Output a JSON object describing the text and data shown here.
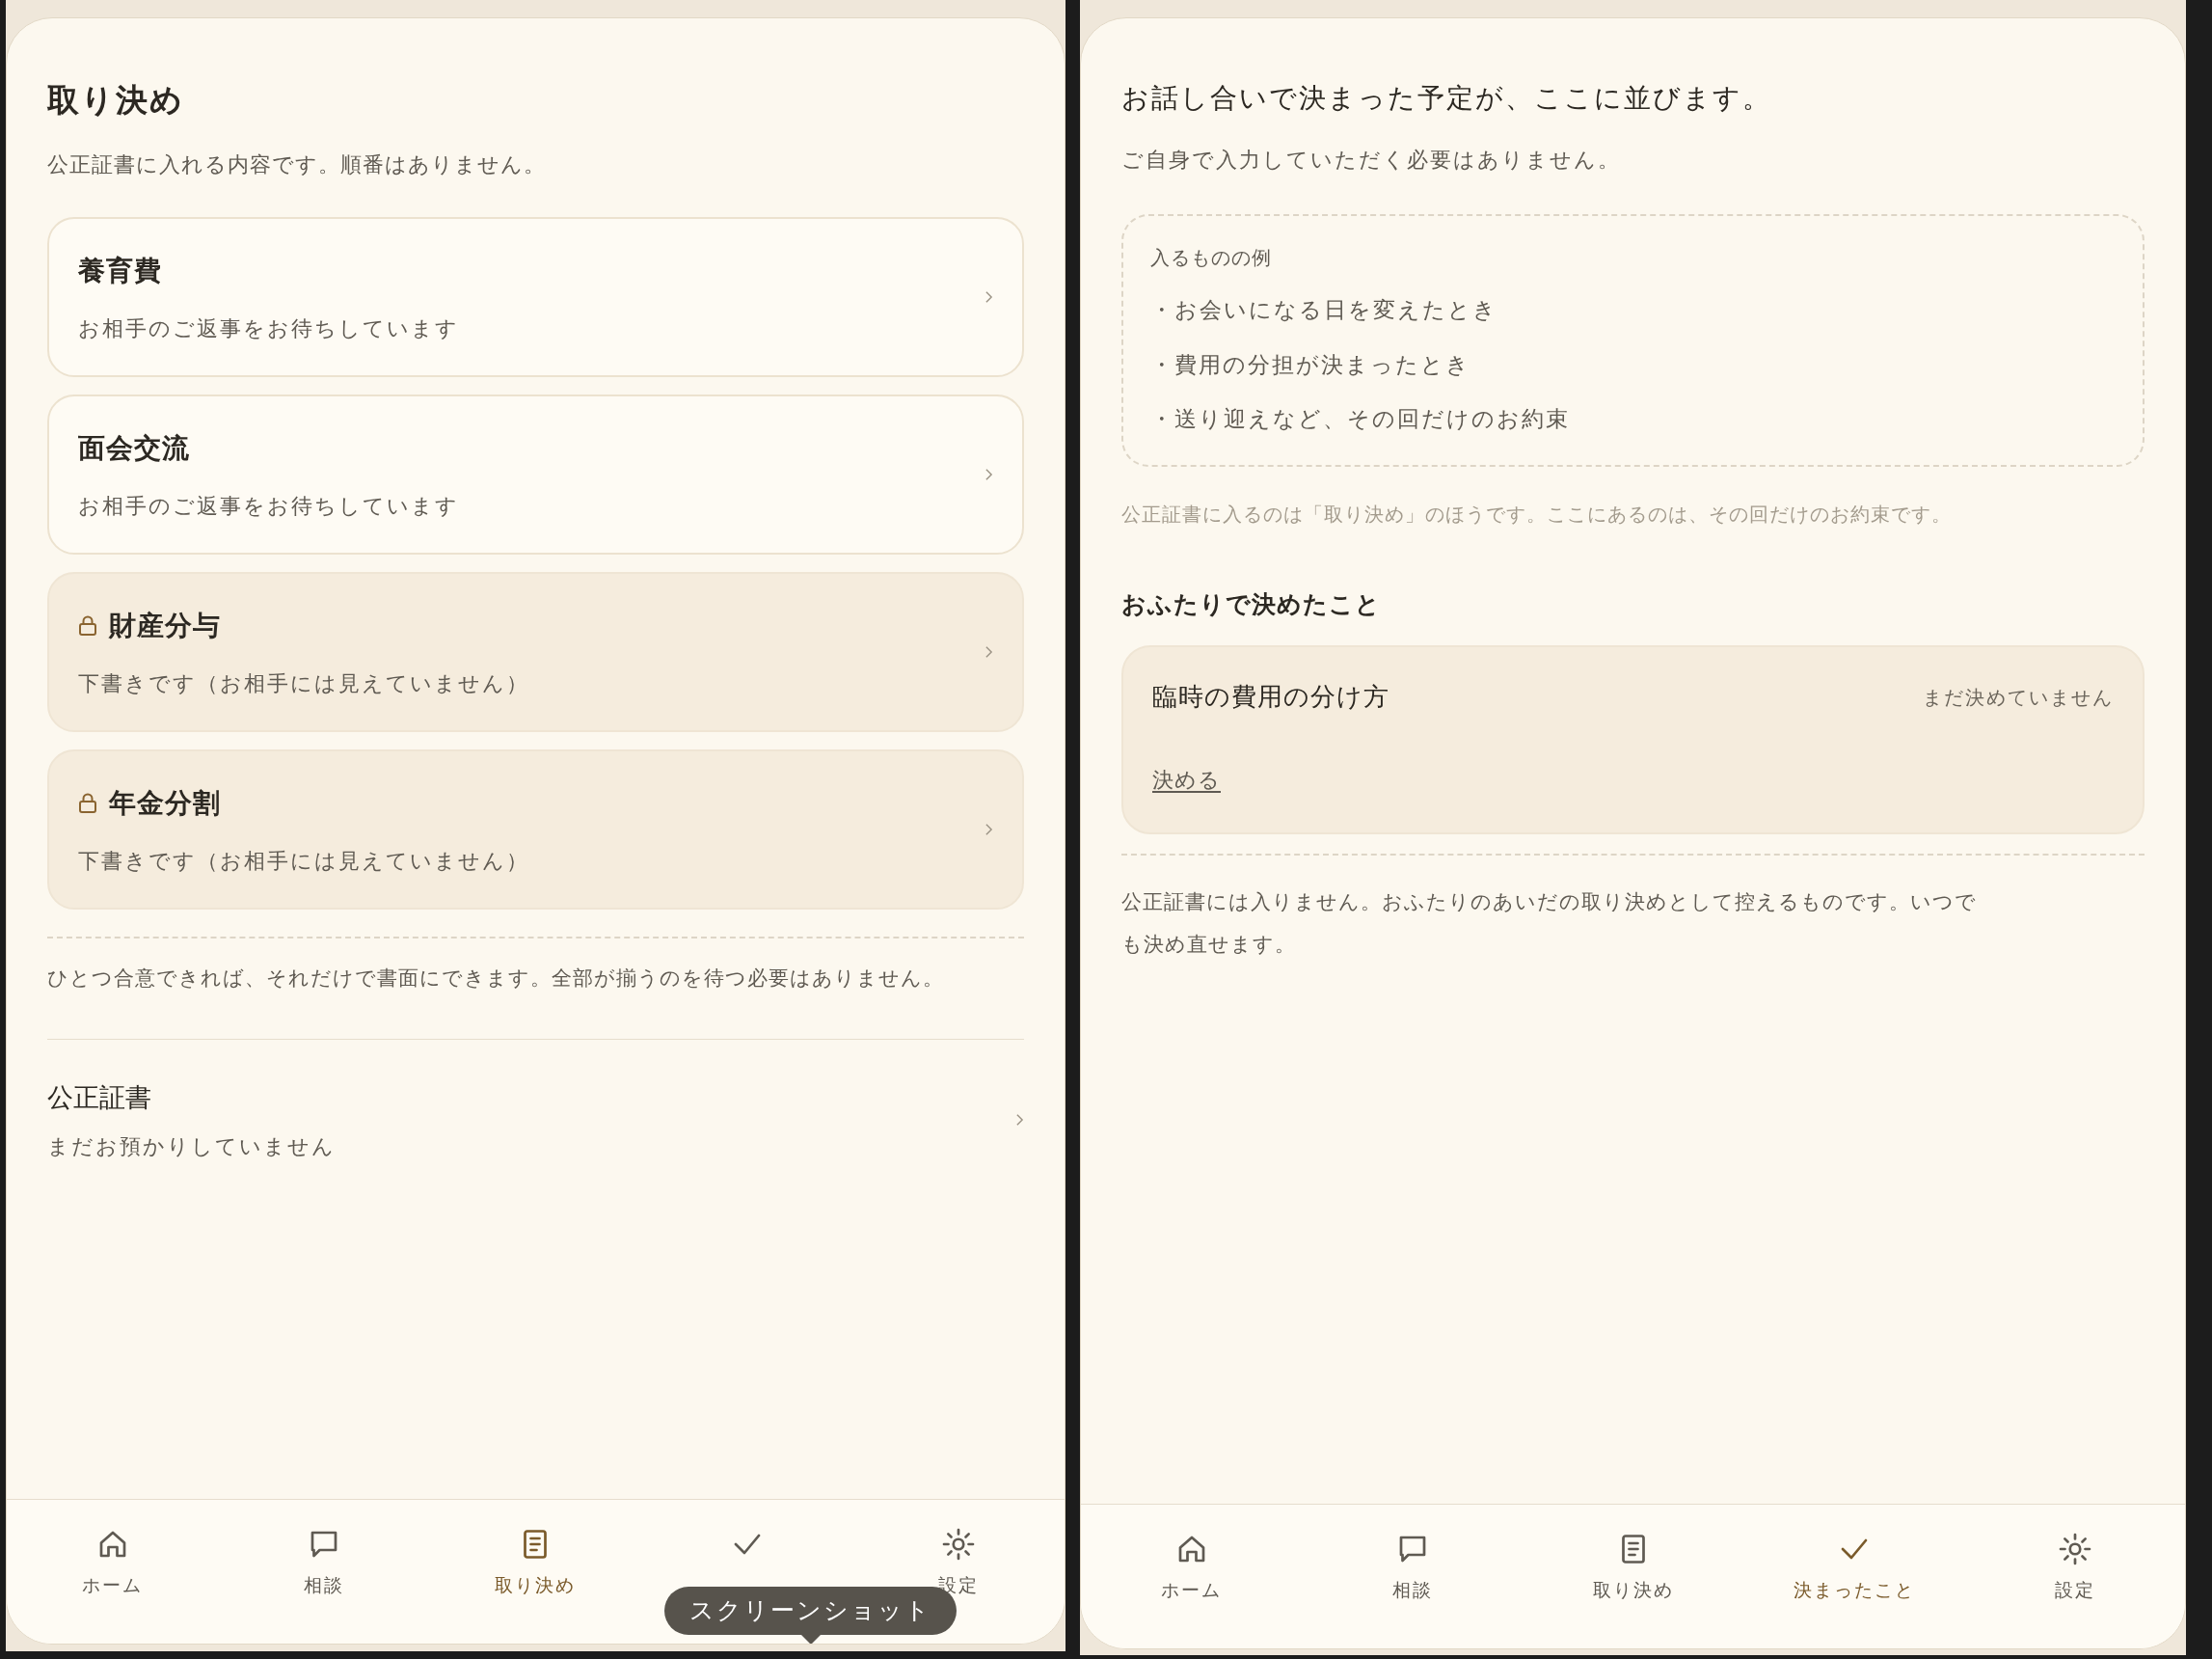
{
  "left_screen": {
    "title": "取り決め",
    "subtitle": "公正証書に入れる内容です。順番はありません。",
    "items": [
      {
        "title": "養育費",
        "status": "お相手のご返事をお待ちしています",
        "locked": false
      },
      {
        "title": "面会交流",
        "status": "お相手のご返事をお待ちしています",
        "locked": false
      },
      {
        "title": "財産分与",
        "status": "下書きです（お相手には見えていません）",
        "locked": true
      },
      {
        "title": "年金分割",
        "status": "下書きです（お相手には見えていません）",
        "locked": true
      }
    ],
    "note": "ひとつ合意できれば、それだけで書面にできます。全部が揃うのを待つ必要はありません。",
    "document": {
      "title": "公正証書",
      "status": "まだお預かりしていません"
    },
    "nav": [
      {
        "kind": "home",
        "label": "ホーム",
        "selected": false
      },
      {
        "kind": "chat",
        "label": "相談",
        "selected": false
      },
      {
        "kind": "document",
        "label": "取り決め",
        "selected": true
      },
      {
        "kind": "check",
        "selected": false
      },
      {
        "kind": "settings",
        "label": "設定",
        "selected": false
      }
    ],
    "tooltip": "スクリーンショット"
  },
  "right_screen": {
    "intro": "お話し合いで決まった予定が、ここに並びます。",
    "subtitle": "ご自身で入力していただく必要はありません。",
    "examples": {
      "title": "入るものの例",
      "items": [
        "・お会いになる日を変えたとき",
        "・費用の分担が決まったとき",
        "・送り迎えなど、その回だけのお約束"
      ]
    },
    "note": "公正証書に入るのは「取り決め」のほうです。ここにあるのは、その回だけのお約束です。",
    "section_title": "おふたりで決めたこと",
    "decisions": [
      {
        "title": "臨時の費用の分け方",
        "status": "まだ決めていません",
        "action": "決める"
      }
    ],
    "footer": "公正証書には入りません。おふたりのあいだの取り決めとして控えるものです。いつでも決め直せます。",
    "nav": [
      {
        "kind": "home",
        "label": "ホーム",
        "selected": false
      },
      {
        "kind": "chat",
        "label": "相談",
        "selected": false
      },
      {
        "kind": "document",
        "label": "取り決め",
        "selected": false
      },
      {
        "kind": "check",
        "label": "決まったこと",
        "selected": true
      },
      {
        "kind": "settings",
        "label": "設定",
        "selected": false
      }
    ]
  }
}
